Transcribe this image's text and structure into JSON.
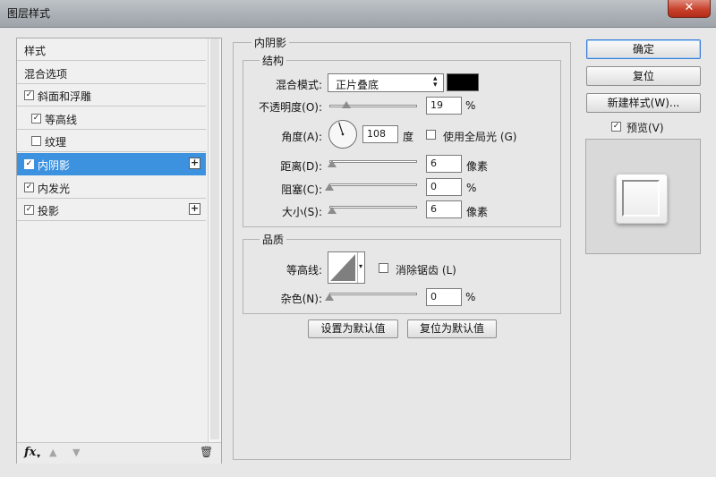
{
  "window": {
    "title": "图层样式",
    "close_glyph": "✕"
  },
  "left_panel": {
    "items": [
      {
        "label": "样式",
        "checkbox": false,
        "checked": false,
        "add": false,
        "selected": false
      },
      {
        "label": "混合选项",
        "checkbox": false,
        "checked": false,
        "add": false,
        "selected": false
      },
      {
        "label": "斜面和浮雕",
        "checkbox": true,
        "checked": true,
        "add": false,
        "selected": false
      },
      {
        "label": "等高线",
        "checkbox": true,
        "checked": true,
        "add": false,
        "selected": false
      },
      {
        "label": "纹理",
        "checkbox": true,
        "checked": false,
        "add": false,
        "selected": false
      },
      {
        "label": "内阴影",
        "checkbox": true,
        "checked": true,
        "add": true,
        "selected": true
      },
      {
        "label": "内发光",
        "checkbox": true,
        "checked": true,
        "add": false,
        "selected": false
      },
      {
        "label": "投影",
        "checkbox": true,
        "checked": true,
        "add": true,
        "selected": false
      }
    ],
    "fx_label": "fx",
    "check_glyph": "✓",
    "plus_glyph": "+",
    "up_glyph": "▲",
    "down_glyph": "▼",
    "trash_glyph": "🗑",
    "selected_color": "#3d92e0"
  },
  "inner_shadow": {
    "section_title": "内阴影",
    "structure": {
      "title": "结构",
      "blend_mode_label": "混合模式:",
      "blend_mode_value": "正片叠底",
      "blend_color": "#000000",
      "opacity_label": "不透明度(O):",
      "opacity_value": "19",
      "opacity_unit": "%",
      "opacity_fraction": 0.19,
      "angle_label": "角度(A):",
      "angle_value": "108",
      "angle_unit": "度",
      "angle_degrees": 108,
      "global_light_label": "使用全局光 (G)",
      "global_light_checked": false,
      "distance_label": "距离(D):",
      "distance_value": "6",
      "distance_unit": "像素",
      "distance_fraction": 0.03,
      "choke_label": "阻塞(C):",
      "choke_value": "0",
      "choke_unit": "%",
      "choke_fraction": 0.0,
      "size_label": "大小(S):",
      "size_value": "6",
      "size_unit": "像素",
      "size_fraction": 0.03
    },
    "quality": {
      "title": "品质",
      "contour_label": "等高线:",
      "anti_alias_label": "消除锯齿 (L)",
      "anti_alias_checked": false,
      "noise_label": "杂色(N):",
      "noise_value": "0",
      "noise_unit": "%",
      "noise_fraction": 0.0
    },
    "make_default_label": "设置为默认值",
    "reset_default_label": "复位为默认值"
  },
  "right": {
    "ok_label": "确定",
    "reset_label": "复位",
    "new_style_label": "新建样式(W)...",
    "preview_label": "预览(V)",
    "preview_checked": true
  }
}
